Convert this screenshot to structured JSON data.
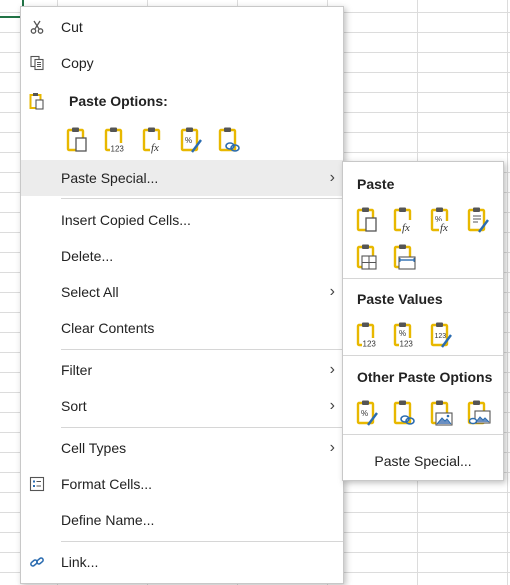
{
  "menu": {
    "cut": "Cut",
    "copy": "Copy",
    "paste_options_heading": "Paste Options:",
    "paste_options": [
      {
        "icon": "paste-icon",
        "badge": ""
      },
      {
        "icon": "paste-values-icon",
        "badge": "123"
      },
      {
        "icon": "paste-formulas-icon",
        "badge": "fx"
      },
      {
        "icon": "paste-formatting-icon",
        "badge": "%"
      },
      {
        "icon": "paste-link-icon",
        "badge": ""
      }
    ],
    "paste_special": "Paste Special...",
    "insert_copied_cells": "Insert Copied Cells...",
    "delete": "Delete...",
    "select_all": "Select All",
    "clear_contents": "Clear Contents",
    "filter": "Filter",
    "sort": "Sort",
    "cell_types": "Cell Types",
    "format_cells": "Format Cells...",
    "define_name": "Define Name...",
    "link": "Link..."
  },
  "submenu": {
    "paste_heading": "Paste",
    "paste_values_heading": "Paste Values",
    "other_heading": "Other Paste Options",
    "paste_special_link": "Paste Special...",
    "paste_row1": [
      {
        "icon": "paste-icon",
        "badge": ""
      },
      {
        "icon": "paste-formulas-icon",
        "badge": "fx"
      },
      {
        "icon": "paste-formulas-number-formatting-icon",
        "badge": "%fx"
      },
      {
        "icon": "keep-source-formatting-icon",
        "badge": ""
      }
    ],
    "paste_row2": [
      {
        "icon": "no-borders-icon",
        "badge": ""
      },
      {
        "icon": "keep-column-widths-icon",
        "badge": ""
      }
    ],
    "values_row": [
      {
        "icon": "values-icon",
        "badge": "123"
      },
      {
        "icon": "values-number-formatting-icon",
        "badge": "%123"
      },
      {
        "icon": "values-source-formatting-icon",
        "badge": "123"
      }
    ],
    "other_row": [
      {
        "icon": "formatting-icon",
        "badge": "%"
      },
      {
        "icon": "paste-link-icon",
        "badge": ""
      },
      {
        "icon": "picture-icon",
        "badge": ""
      },
      {
        "icon": "linked-picture-icon",
        "badge": ""
      }
    ]
  },
  "colors": {
    "clipboard": "#e8b800",
    "accent": "#217346",
    "hover": "#ececec"
  }
}
